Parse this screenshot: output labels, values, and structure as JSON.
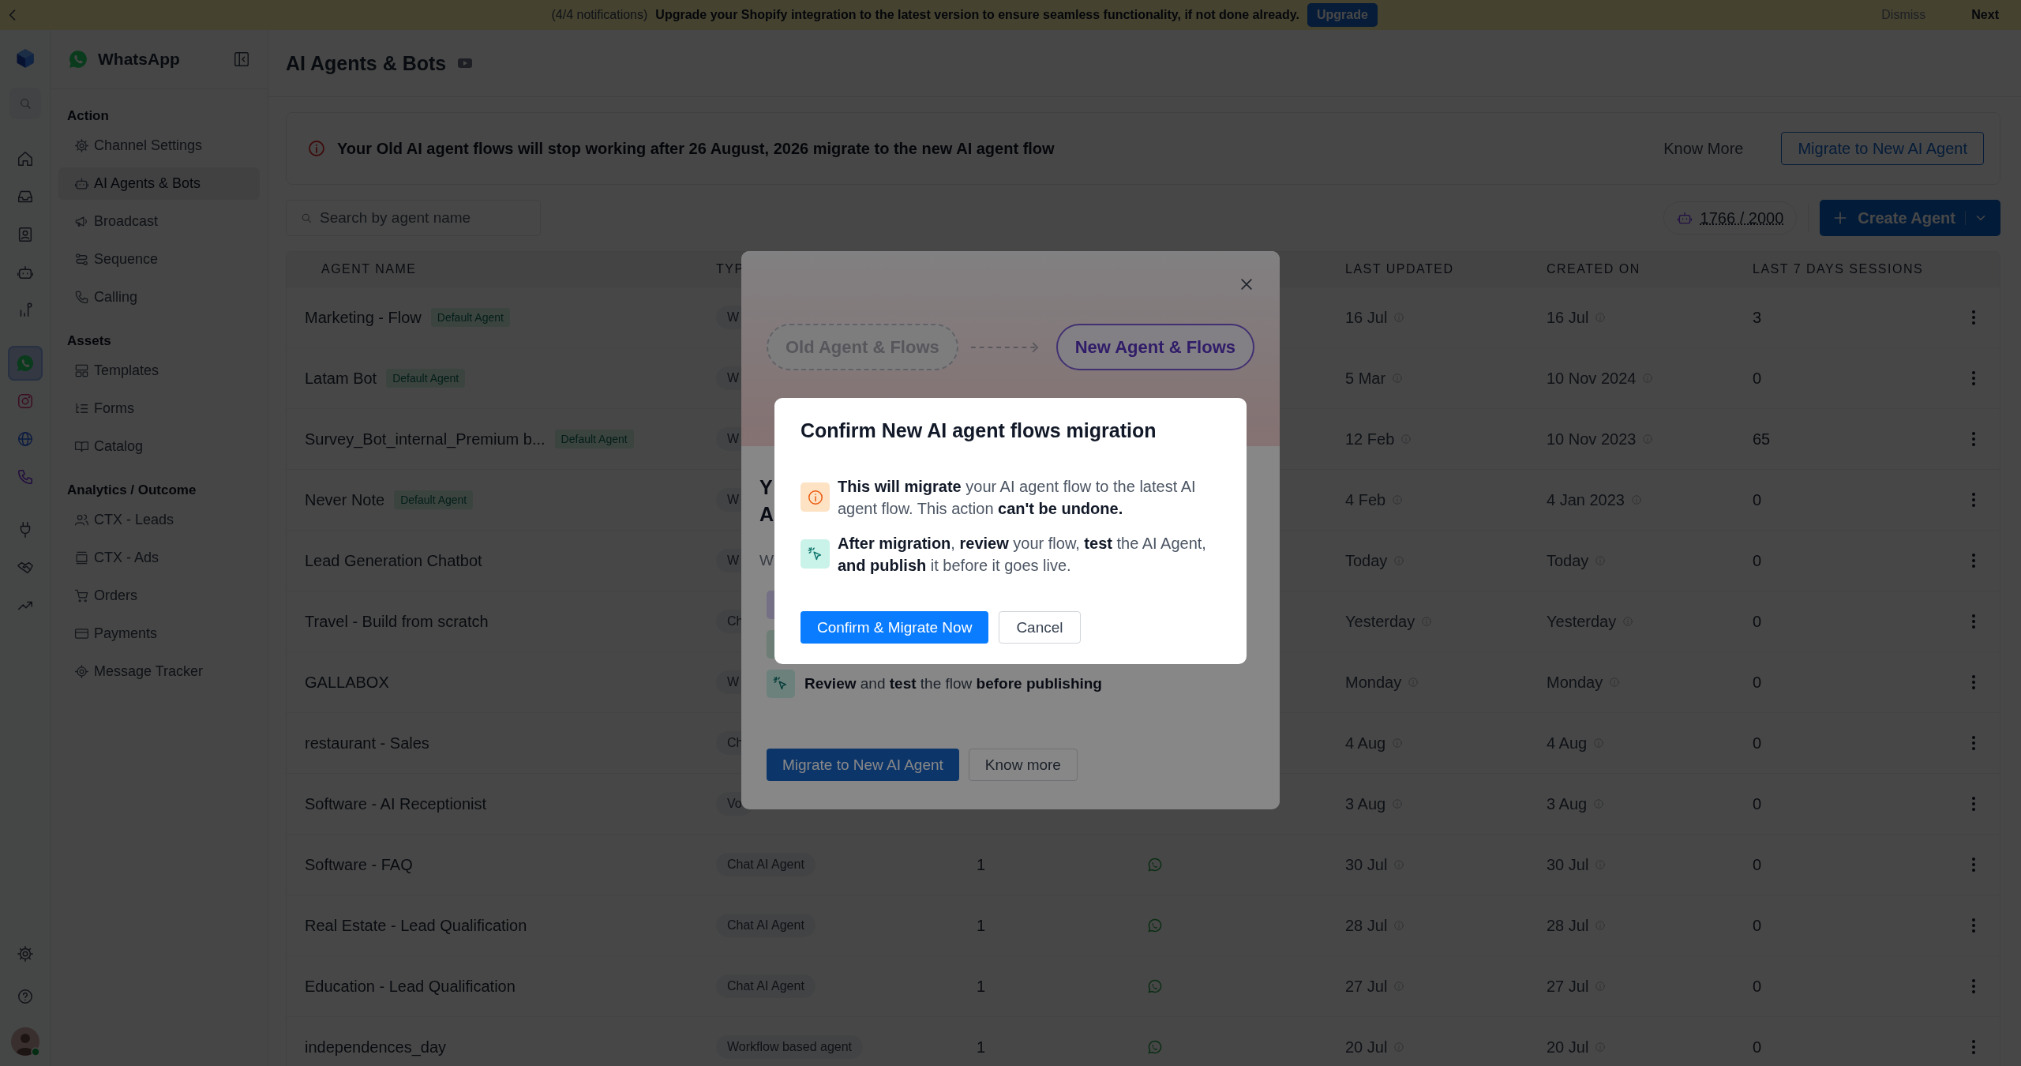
{
  "banner": {
    "count": "(4/4 notifications)",
    "message": "Upgrade your Shopify integration to the latest version to ensure seamless functionality, if not done already.",
    "action": "Upgrade",
    "dismiss": "Dismiss",
    "next": "Next"
  },
  "rail": [
    {
      "selected": false
    },
    {
      "selected": false
    },
    {
      "selected": false
    },
    {
      "selected": false
    },
    {
      "selected": false
    },
    {
      "selected": true
    },
    {
      "selected": false
    },
    {
      "selected": false
    },
    {
      "selected": false
    },
    {
      "selected": false
    },
    {
      "selected": false
    },
    {
      "selected": false
    },
    {
      "selected": false
    },
    {
      "selected": false
    }
  ],
  "sidebar": {
    "channel": "WhatsApp",
    "sections": [
      {
        "title": "Action",
        "items": [
          {
            "label": "Channel Settings",
            "selected": false
          },
          {
            "label": "AI Agents & Bots",
            "selected": true
          },
          {
            "label": "Broadcast",
            "selected": false
          },
          {
            "label": "Sequence",
            "selected": false
          },
          {
            "label": "Calling",
            "selected": false
          }
        ]
      },
      {
        "title": "Assets",
        "items": [
          {
            "label": "Templates",
            "selected": false
          },
          {
            "label": "Forms",
            "selected": false
          },
          {
            "label": "Catalog",
            "selected": false
          }
        ]
      },
      {
        "title": "Analytics / Outcome",
        "items": [
          {
            "label": "CTX - Leads",
            "selected": false
          },
          {
            "label": "CTX - Ads",
            "selected": false
          },
          {
            "label": "Orders",
            "selected": false
          },
          {
            "label": "Payments",
            "selected": false
          },
          {
            "label": "Message Tracker",
            "selected": false
          }
        ]
      }
    ]
  },
  "page": {
    "title": "AI Agents & Bots"
  },
  "alert": {
    "message": "Your Old AI agent flows will stop working after 26 August, 2026 migrate to the new AI agent flow",
    "link": "Know More",
    "button": "Migrate to New AI Agent"
  },
  "search": {
    "placeholder": "Search by agent name"
  },
  "usage": "1766 / 2000",
  "create_button": "Create Agent",
  "table": {
    "columns": [
      "AGENT NAME",
      "TYP",
      "LAST UPDATED",
      "CREATED ON",
      "LAST 7 DAYS SESSIONS"
    ],
    "rows": [
      {
        "name": "Marketing - Flow",
        "tag": "Default Agent",
        "type": "W",
        "last_updated": "16 Jul",
        "created_on": "16 Jul",
        "sessions": "3"
      },
      {
        "name": "Latam Bot",
        "tag": "Default Agent",
        "type": "W",
        "last_updated": "5 Mar",
        "created_on": "10 Nov 2024",
        "sessions": "0"
      },
      {
        "name": "Survey_Bot_internal_Premium b...",
        "tag": "Default Agent",
        "type": "W",
        "last_updated": "12 Feb",
        "created_on": "10 Nov 2023",
        "sessions": "65"
      },
      {
        "name": "Never Note",
        "tag": "Default Agent",
        "type": "W",
        "last_updated": "4 Feb",
        "created_on": "4 Jan 2023",
        "sessions": "0"
      },
      {
        "name": "Lead Generation Chatbot",
        "type": "W",
        "last_updated": "Today",
        "created_on": "Today",
        "sessions": "0"
      },
      {
        "name": "Travel - Build from scratch",
        "type": "Ch",
        "last_updated": "Yesterday",
        "created_on": "Yesterday",
        "sessions": "0"
      },
      {
        "name": "GALLABOX",
        "type": "W",
        "last_updated": "Monday",
        "created_on": "Monday",
        "sessions": "0"
      },
      {
        "name": "restaurant - Sales",
        "type": "Ch",
        "last_updated": "4 Aug",
        "created_on": "4 Aug",
        "sessions": "0"
      },
      {
        "name": "Software - AI Receptionist",
        "type": "Vo",
        "last_updated": "3 Aug",
        "created_on": "3 Aug",
        "sessions": "0"
      },
      {
        "name": "Software - FAQ",
        "type": "Chat AI Agent",
        "count": "1",
        "last_updated": "30 Jul",
        "created_on": "30 Jul",
        "sessions": "0"
      },
      {
        "name": "Real Estate - Lead Qualification",
        "type": "Chat AI Agent",
        "count": "1",
        "last_updated": "28 Jul",
        "created_on": "28 Jul",
        "sessions": "0"
      },
      {
        "name": "Education - Lead Qualification",
        "type": "Chat AI Agent",
        "count": "1",
        "last_updated": "27 Jul",
        "created_on": "27 Jul",
        "sessions": "0"
      },
      {
        "name": "independences_day",
        "type": "Workflow based agent",
        "count": "1",
        "last_updated": "20 Jul",
        "created_on": "20 Jul",
        "sessions": "0"
      }
    ]
  },
  "migration_modal": {
    "from": "Old Agent & Flows",
    "to": "New Agent & Flows",
    "heading_lines": [
      "Y",
      "A"
    ],
    "subtitle": "W",
    "features": [
      {
        "kind": "agent"
      },
      {
        "kind": "channel"
      },
      {
        "kind": "review",
        "text": "**Review** and **test** the flow **before publishing**"
      }
    ],
    "primary": "Migrate to New AI Agent",
    "secondary": "Know more"
  },
  "confirm_dialog": {
    "title": "Confirm New AI agent flows migration",
    "items": [
      {
        "kind": "warning",
        "text": "**This will migrate** your AI agent flow to the latest AI agent flow. This action **can't be undone.**"
      },
      {
        "kind": "cursor",
        "text": "**After migration**, **review** your flow, **test** the AI Agent, **and publish** it before it goes live."
      }
    ],
    "confirm": "Confirm & Migrate Now",
    "cancel": "Cancel"
  }
}
